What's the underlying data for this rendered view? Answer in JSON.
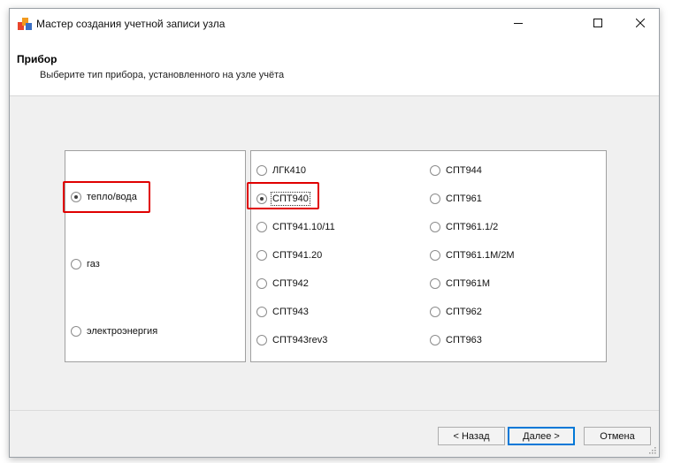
{
  "window": {
    "title": "Мастер создания учетной записи узла",
    "icon": "app-icon"
  },
  "header": {
    "title": "Прибор",
    "subtitle": "Выберите тип прибора, установленного на узле учёта"
  },
  "categories": [
    {
      "label": "тепло/вода",
      "checked": true
    },
    {
      "label": "газ",
      "checked": false
    },
    {
      "label": "электроэнергия",
      "checked": false
    }
  ],
  "devices": {
    "col1": [
      {
        "label": "ЛГК410",
        "checked": false
      },
      {
        "label": "СПТ940",
        "checked": true
      },
      {
        "label": "СПТ941.10/11",
        "checked": false
      },
      {
        "label": "СПТ941.20",
        "checked": false
      },
      {
        "label": "СПТ942",
        "checked": false
      },
      {
        "label": "СПТ943",
        "checked": false
      },
      {
        "label": "СПТ943rev3",
        "checked": false
      }
    ],
    "col2": [
      {
        "label": "СПТ944",
        "checked": false
      },
      {
        "label": "СПТ961",
        "checked": false
      },
      {
        "label": "СПТ961.1/2",
        "checked": false
      },
      {
        "label": "СПТ961.1М/2М",
        "checked": false
      },
      {
        "label": "СПТ961М",
        "checked": false
      },
      {
        "label": "СПТ962",
        "checked": false
      },
      {
        "label": "СПТ963",
        "checked": false
      }
    ]
  },
  "buttons": {
    "back": "< Назад",
    "next": "Далее >",
    "cancel": "Отмена"
  },
  "colors": {
    "highlight": "#e00000",
    "default_button_border": "#0078d7"
  }
}
